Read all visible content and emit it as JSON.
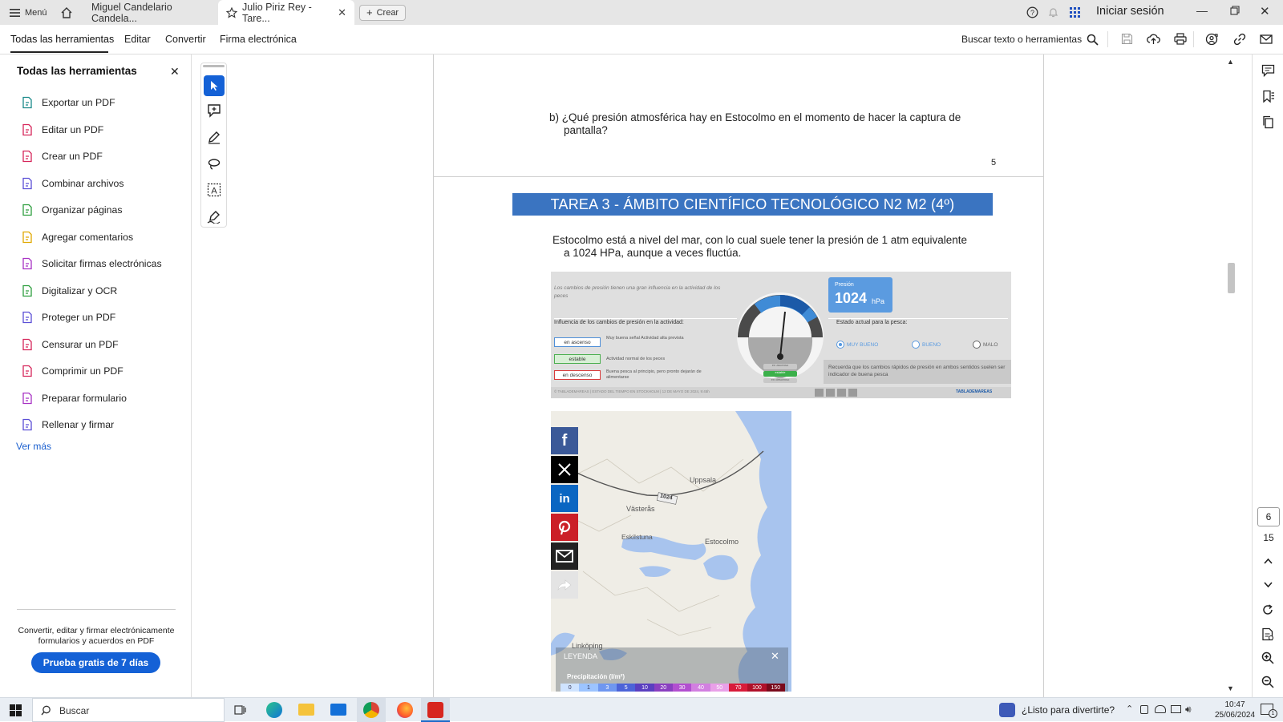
{
  "browser": {
    "menu_label": "Menú",
    "tabs": [
      {
        "label": "Miguel Candelario Candela..."
      },
      {
        "label": "Julio Piriz Rey - Tare..."
      }
    ],
    "new_tab_label": "Crear",
    "sign_in_label": "Iniciar sesión"
  },
  "menubar": {
    "items": [
      "Todas las herramientas",
      "Editar",
      "Convertir",
      "Firma electrónica"
    ],
    "search_label": "Buscar texto o herramientas"
  },
  "sidebar": {
    "title": "Todas las herramientas",
    "tools": [
      {
        "label": "Exportar un PDF",
        "color": "#1b8a8a"
      },
      {
        "label": "Editar un PDF",
        "color": "#d6265a"
      },
      {
        "label": "Crear un PDF",
        "color": "#d6265a"
      },
      {
        "label": "Combinar archivos",
        "color": "#5b4fd6"
      },
      {
        "label": "Organizar páginas",
        "color": "#2e9e3f"
      },
      {
        "label": "Agregar comentarios",
        "color": "#e0a800"
      },
      {
        "label": "Solicitar firmas electrónicas",
        "color": "#a832c4"
      },
      {
        "label": "Digitalizar y OCR",
        "color": "#2e9e3f"
      },
      {
        "label": "Proteger un PDF",
        "color": "#5b4fd6"
      },
      {
        "label": "Censurar un PDF",
        "color": "#d6265a"
      },
      {
        "label": "Comprimir un PDF",
        "color": "#d6265a"
      },
      {
        "label": "Preparar formulario",
        "color": "#a832c4"
      },
      {
        "label": "Rellenar y firmar",
        "color": "#5b4fd6"
      }
    ],
    "more_label": "Ver más",
    "promo_text": "Convertir, editar y firmar electrónicamente formularios y acuerdos en PDF",
    "trial_button": "Prueba gratis de 7 días"
  },
  "document": {
    "question_b_line1": "b) ¿Qué presión atmosférica hay en Estocolmo en el momento de hacer la captura de",
    "question_b_line2": "pantalla?",
    "page_number": "5",
    "task_title": "TAREA 3  - ÁMBITO CIENTÍFICO TECNOLÓGICO N2 M2 (4º)",
    "intro_line1": "Estocolmo está a nivel del mar, con lo cual suele tener la presión de 1 atm equivalente",
    "intro_line2": "a 1024 HPa, aunque a veces fluctúa.",
    "widget": {
      "lead": "Los cambios de presión tienen una gran influencia en la actividad de los peces",
      "influence_title": "Influencia de los cambios de presión en la actividad:",
      "rows": [
        {
          "tag": "en ascenso",
          "text": "Muy buena señal Actividad alta prevista"
        },
        {
          "tag": "estable",
          "text": "Actividad normal de los peces"
        },
        {
          "tag": "en descenso",
          "text": "Buena pesca al principio, pero pronto dejarán de alimentarse"
        }
      ],
      "gauge_labels": [
        "en ascenso",
        "estable",
        "en descenso"
      ],
      "pressure_label": "Presión",
      "pressure_value": "1024",
      "pressure_unit": "hPa",
      "state_title": "Estado actual para la pesca:",
      "options": [
        "MUY BUENO",
        "BUENO",
        "MALO"
      ],
      "note": "Recuerda que los cambios rápidos de presión en ambos sentidos suelen ser indicador de buena pesca",
      "footer": "© TABLADEMAREAS | ESTADO DEL TIEMPO EN STOCKHOLM | 12 DE MAYO DE 2024, 9:45h",
      "brand": "TABLADEMAREAS"
    },
    "map": {
      "places": [
        "Uppsala",
        "Västerås",
        "Eskilstuna",
        "Estocolmo",
        "Linköping"
      ],
      "isobar_label": "1024",
      "legend_title": "LEYENDA",
      "legend_subtitle": "Precipitación (l/m²)",
      "legend_values": [
        "0",
        "1",
        "3",
        "5",
        "10",
        "20",
        "30",
        "40",
        "50",
        "70",
        "100",
        "150"
      ],
      "legend_colors": [
        "#cfe3ff",
        "#9cc4ff",
        "#6f97f0",
        "#4c63d8",
        "#5a3fc0",
        "#8a3fc0",
        "#b24fd0",
        "#d27fe0",
        "#e9a0e8",
        "#d81b3a",
        "#b0102a",
        "#7a0a1c"
      ]
    }
  },
  "page_nav": {
    "current": "6",
    "total": "15"
  },
  "taskbar": {
    "search_placeholder": "Buscar",
    "notification_text": "¿Listo para divertirte?",
    "time": "10:47",
    "date": "25/06/2024",
    "badge": "1"
  }
}
